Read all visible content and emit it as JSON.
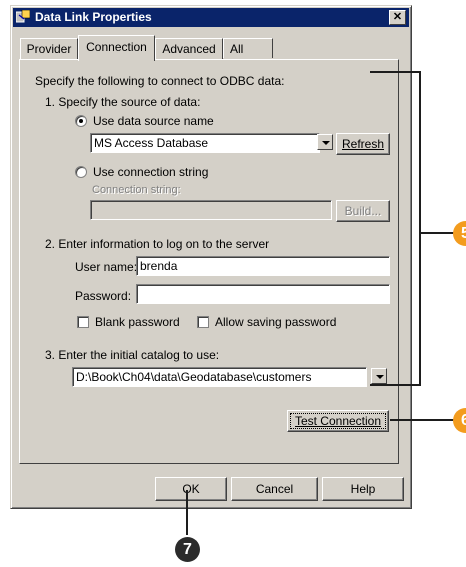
{
  "window": {
    "title": "Data Link Properties",
    "close_glyph": "✕"
  },
  "tabs": [
    {
      "label": "Provider",
      "active": false
    },
    {
      "label": "Connection",
      "active": true
    },
    {
      "label": "Advanced",
      "active": false
    },
    {
      "label": "All",
      "active": false
    }
  ],
  "intro": "Specify the following to connect to ODBC data:",
  "step1": {
    "label": "1. Specify the source of data:",
    "radio_dsn": {
      "label": "Use data source name",
      "selected": true
    },
    "dsn_value": "MS Access Database",
    "refresh_label": "Refresh",
    "radio_connstr": {
      "label": "Use connection string",
      "selected": false
    },
    "connstr_label": "Connection string:",
    "connstr_value": "",
    "build_label": "Build..."
  },
  "step2": {
    "label": "2. Enter information to log on to the server",
    "username_label": "User name:",
    "username_value": "brenda",
    "password_label": "Password:",
    "password_value": "",
    "blank_password_label": "Blank password",
    "blank_password_checked": false,
    "allow_saving_label": "Allow saving password",
    "allow_saving_checked": false
  },
  "step3": {
    "label": "3. Enter the initial catalog to use:",
    "catalog_value": "D:\\Book\\Ch04\\data\\Geodatabase\\customers"
  },
  "test_connection_label": "Test Connection",
  "footer": {
    "ok_label": "OK",
    "cancel_label": "Cancel",
    "help_label": "Help"
  },
  "callouts": {
    "c5": "5",
    "c6": "6",
    "c7": "7"
  },
  "colors": {
    "titlebar": "#0a246a",
    "face": "#d4d0c8",
    "callout_orange": "#f39c1e",
    "callout_dark": "#2b2b2b"
  }
}
